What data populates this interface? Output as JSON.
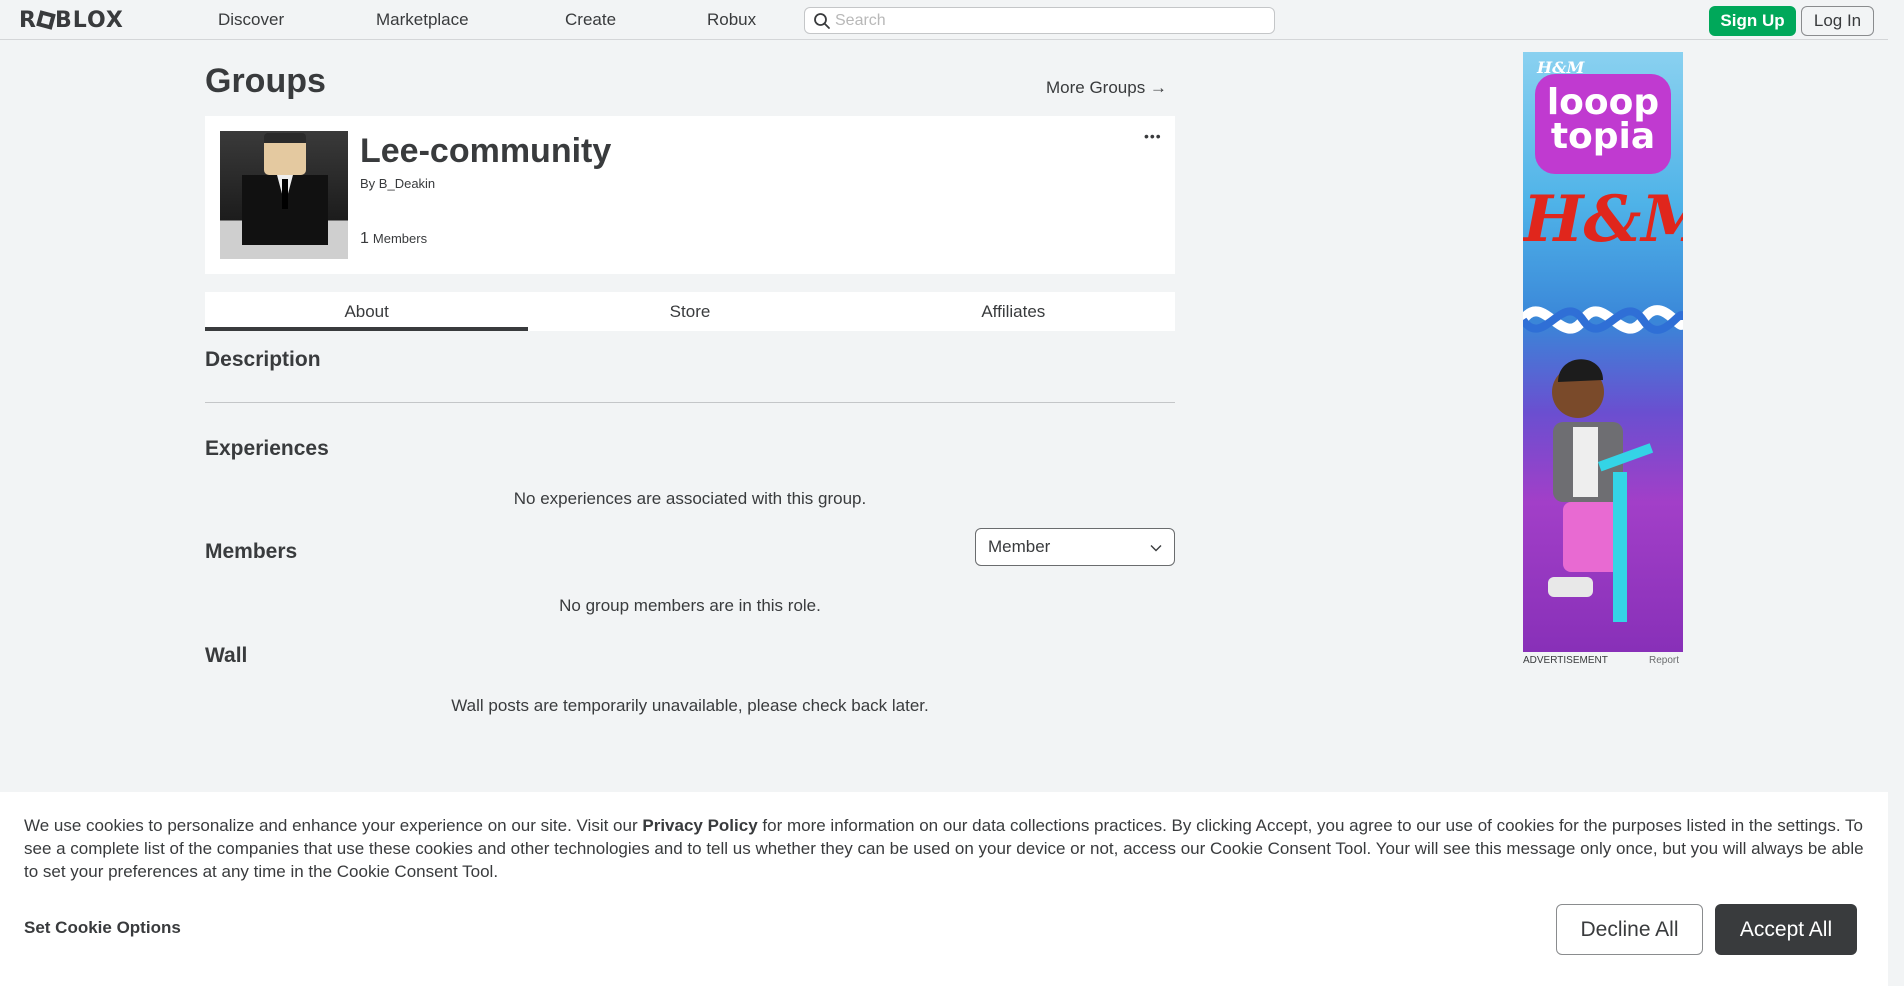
{
  "nav": {
    "logo": "ROBLOX",
    "links": [
      "Discover",
      "Marketplace",
      "Create",
      "Robux"
    ],
    "search_placeholder": "Search",
    "signup_label": "Sign Up",
    "login_label": "Log In"
  },
  "page": {
    "title": "Groups",
    "more_groups": "More Groups →"
  },
  "group": {
    "name": "Lee-community",
    "by_prefix": "By",
    "owner": "B_Deakin",
    "member_count": "1",
    "members_label": "Members",
    "more_menu": "•••"
  },
  "tabs": [
    {
      "label": "About",
      "active": true
    },
    {
      "label": "Store",
      "active": false
    },
    {
      "label": "Affiliates",
      "active": false
    }
  ],
  "sections": {
    "description": "Description",
    "experiences": "Experiences",
    "experiences_empty": "No experiences are associated with this group.",
    "members": "Members",
    "role_select": "Member",
    "members_empty": "No group members are in this role.",
    "wall": "Wall",
    "wall_empty": "Wall posts are temporarily unavailable, please check back later."
  },
  "ad": {
    "brand_small": "H&M",
    "loop_line1": "looop",
    "loop_line2": "topia",
    "brand_big": "H&M",
    "label": "ADVERTISEMENT",
    "report": "Report"
  },
  "cookie": {
    "text_before": "We use cookies to personalize and enhance your experience on our site. Visit our ",
    "privacy_link": "Privacy Policy",
    "text_after": " for more information on our data collections practices. By clicking Accept, you agree to our use of cookies for the purposes listed in the settings. To see a complete list of the companies that use these cookies and other technologies and to tell us whether they can be used on your device or not, access our Cookie Consent Tool. Your will see this message only once, but you will always be able to set your preferences at any time in the Cookie Consent Tool.",
    "options_label": "Set Cookie Options",
    "decline_label": "Decline All",
    "accept_label": "Accept All"
  },
  "colors": {
    "accent_green": "#00a85a",
    "text": "#393b3d",
    "background": "#f2f4f5"
  }
}
